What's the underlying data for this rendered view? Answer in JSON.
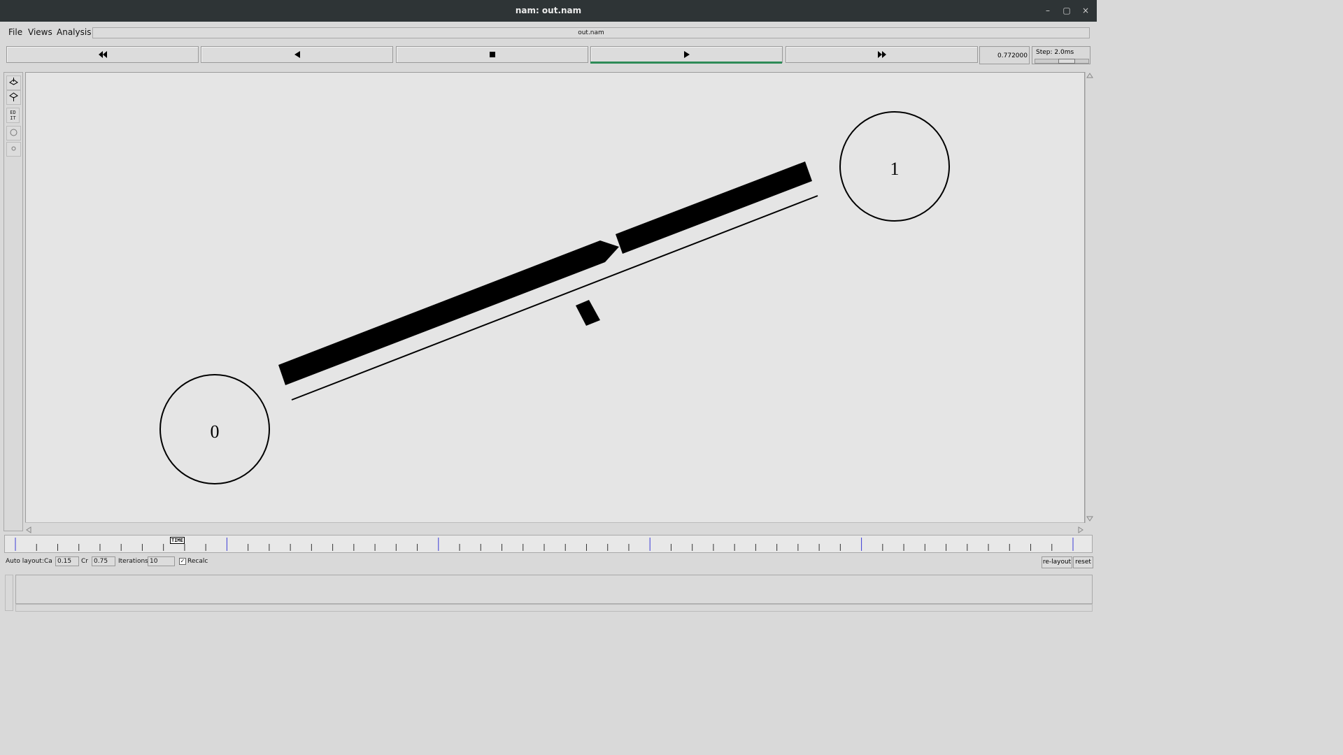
{
  "window": {
    "title": "nam: out.nam",
    "minimize_glyph": "–",
    "maximize_glyph": "▢",
    "close_glyph": "×"
  },
  "menubar": {
    "file": "File",
    "views": "Views",
    "analysis": "Analysis",
    "filename": "out.nam"
  },
  "controls": {
    "rewind_icon": "rewind-icon",
    "back_icon": "step-back-icon",
    "stop_icon": "stop-icon",
    "play_icon": "play-icon",
    "forward_icon": "fast-forward-icon",
    "time": "0.772000",
    "step_label": "Step: 2.0ms",
    "play_active_color": "#2e8b57"
  },
  "tools": {
    "edit": "ED IT"
  },
  "network": {
    "node_0": "0",
    "node_1": "1"
  },
  "timeline": {
    "marker_text": "TIME",
    "tick_count": 51,
    "major_every": 10
  },
  "autolayout": {
    "label": "Auto layout:",
    "ca_label": "Ca",
    "ca_value": "0.15",
    "cr_label": "Cr",
    "cr_value": "0.75",
    "iterations_label": "Iterations",
    "iterations_value": "10",
    "recalc_label": "Recalc",
    "recalc_checked": true,
    "relayout_label": "re-layout",
    "reset_label": "reset"
  }
}
